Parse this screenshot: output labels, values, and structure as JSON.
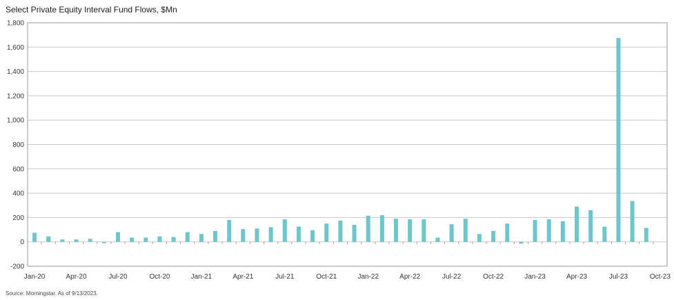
{
  "colors": {
    "bar": "#6cc6cc",
    "grid": "#c8c8c8",
    "frame": "#9a9a9a",
    "text": "#333333"
  },
  "chart_data": {
    "type": "bar",
    "title": "Select Private Equity Interval Fund Flows, $Mn",
    "source": "Source: Morningstar. As of 9/13/2023.",
    "xlabel": "",
    "ylabel": "",
    "ylim": [
      -200,
      1800
    ],
    "yticks": [
      -200,
      0,
      200,
      400,
      600,
      800,
      1000,
      1200,
      1400,
      1600,
      1800
    ],
    "ytick_labels": [
      "-200",
      "0",
      "200",
      "400",
      "600",
      "800",
      "1,000",
      "1,200",
      "1,400",
      "1,600",
      "1,800"
    ],
    "grid": true,
    "legend": "none",
    "categories": [
      "Jan-20",
      "Feb-20",
      "Mar-20",
      "Apr-20",
      "May-20",
      "Jun-20",
      "Jul-20",
      "Aug-20",
      "Sep-20",
      "Oct-20",
      "Nov-20",
      "Dec-20",
      "Jan-21",
      "Feb-21",
      "Mar-21",
      "Apr-21",
      "May-21",
      "Jun-21",
      "Jul-21",
      "Aug-21",
      "Sep-21",
      "Oct-21",
      "Nov-21",
      "Dec-21",
      "Jan-22",
      "Feb-22",
      "Mar-22",
      "Apr-22",
      "May-22",
      "Jun-22",
      "Jul-22",
      "Aug-22",
      "Sep-22",
      "Oct-22",
      "Nov-22",
      "Dec-22",
      "Jan-23",
      "Feb-23",
      "Mar-23",
      "Apr-23",
      "May-23",
      "Jun-23",
      "Jul-23",
      "Aug-23",
      "Sep-23",
      "Oct-23"
    ],
    "xtick_labels": [
      "Jan-20",
      "Apr-20",
      "Jul-20",
      "Oct-20",
      "Jan-21",
      "Apr-21",
      "Jul-21",
      "Oct-21",
      "Jan-22",
      "Apr-22",
      "Jul-22",
      "Oct-22",
      "Jan-23",
      "Apr-23",
      "Jul-23",
      "Oct-23"
    ],
    "values": [
      75,
      45,
      20,
      20,
      25,
      -10,
      80,
      35,
      35,
      45,
      40,
      80,
      65,
      90,
      180,
      105,
      110,
      120,
      185,
      125,
      95,
      150,
      175,
      140,
      215,
      220,
      190,
      185,
      185,
      35,
      145,
      190,
      65,
      90,
      150,
      -15,
      180,
      185,
      170,
      290,
      260,
      125,
      1675,
      335,
      115,
      0
    ]
  }
}
